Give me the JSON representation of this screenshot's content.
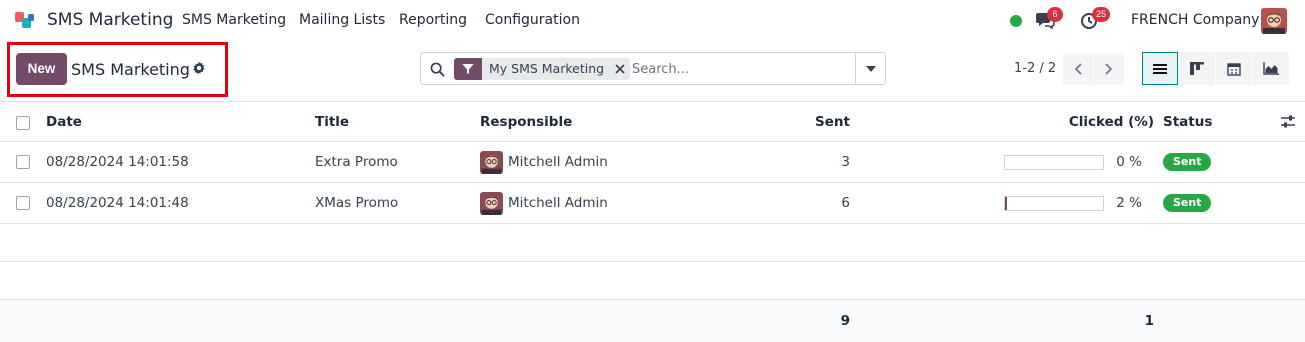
{
  "app": {
    "name": "SMS Marketing"
  },
  "menu": [
    {
      "label": "SMS Marketing"
    },
    {
      "label": "Mailing Lists"
    },
    {
      "label": "Reporting"
    },
    {
      "label": "Configuration"
    }
  ],
  "systray": {
    "messages_count": "6",
    "activities_count": "25",
    "company": "FRENCH Company"
  },
  "control_panel": {
    "new_label": "New",
    "title": "SMS Marketing",
    "filter_facet": "My SMS Marketing",
    "search_placeholder": "Search...",
    "pager": "1-2 / 2"
  },
  "colors": {
    "brand": "#714b67",
    "status_green": "#28a745",
    "badge_red": "#d9303e",
    "active_view": "#017e84"
  },
  "table": {
    "columns": [
      "Date",
      "Title",
      "Responsible",
      "Sent",
      "Clicked (%)",
      "Status"
    ],
    "rows": [
      {
        "date": "08/28/2024 14:01:58",
        "title": "Extra Promo",
        "responsible": "Mitchell Admin",
        "sent": "3",
        "clicked": "0 %",
        "clicked_value": 0,
        "status": "Sent"
      },
      {
        "date": "08/28/2024 14:01:48",
        "title": "XMas Promo",
        "responsible": "Mitchell Admin",
        "sent": "6",
        "clicked": "2 %",
        "clicked_value": 2,
        "status": "Sent"
      }
    ],
    "totals": {
      "sent": "9",
      "clicked": "1"
    }
  }
}
